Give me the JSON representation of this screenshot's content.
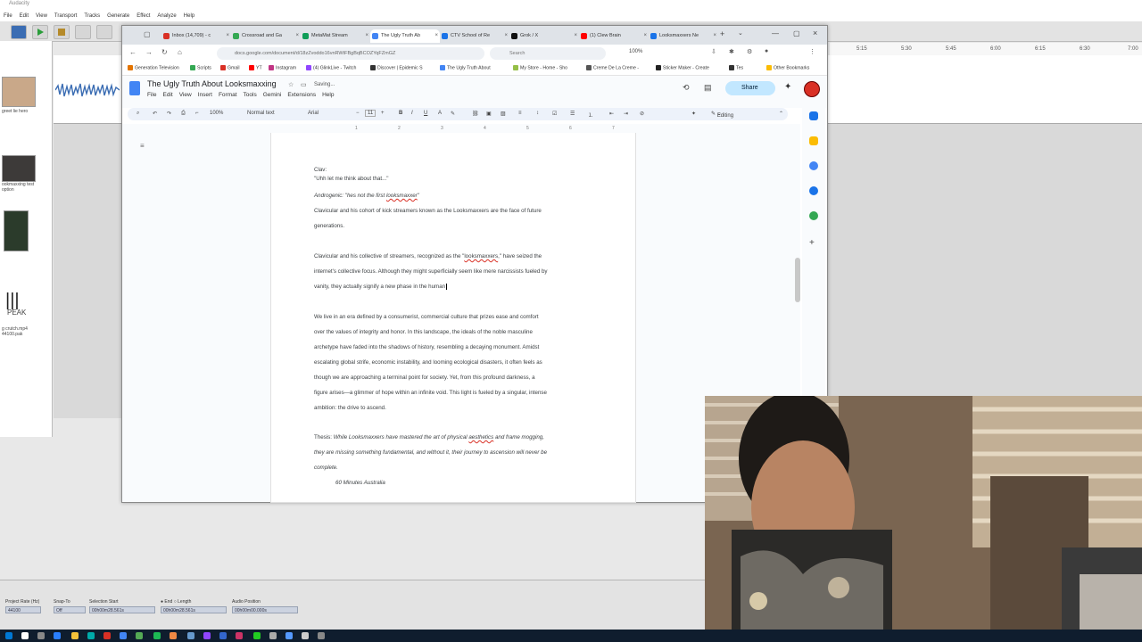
{
  "audacity": {
    "title": "Audacity",
    "menu": [
      "File",
      "Edit",
      "View",
      "Transport",
      "Tracks",
      "Generate",
      "Effect",
      "Analyze",
      "Help"
    ],
    "ruler_ticks": [
      "5:15",
      "5:30",
      "5:45",
      "6:00",
      "6:15",
      "6:30",
      "7:00"
    ],
    "left_items": [
      "greet lie hero",
      "ookmaxxing test option",
      "PEAK",
      "g crutch.mp4 44100.pak"
    ],
    "bottom": {
      "project_rate_label": "Project Rate (Hz)",
      "project_rate": "44100",
      "snap_label": "Snap-To",
      "snap_value": "Off",
      "selection_label": "Selection Start",
      "sel_start": "00h00m28.561s",
      "end_label": "End",
      "length_label": "Length",
      "sel_end": "00h00m28.561s",
      "audio_position_label": "Audio Position",
      "audio_position": "00h00m00.000s"
    }
  },
  "chrome": {
    "tabs": [
      {
        "label": "Inbox (14,709) - c",
        "color": "#d93025"
      },
      {
        "label": "Crossroad and Ga",
        "color": "#34a853"
      },
      {
        "label": "MetaMat Stream",
        "color": "#0f9d58"
      },
      {
        "label": "The Ugly Truth Ab",
        "color": "#4285f4"
      },
      {
        "label": "CTV School of Re",
        "color": "#1a73e8"
      },
      {
        "label": "Grok / X",
        "color": "#111111"
      },
      {
        "label": "(1) Clew Brain",
        "color": "#ff0000"
      },
      {
        "label": "Looksmaxxers Ne",
        "color": "#1a73e8"
      }
    ],
    "url": "docs.google.com/document/d/18zZvoddo16vnRWtFBgBqBCOZYqFZmGZ",
    "search_placeholder": "Search",
    "zoom_text": "100%",
    "bookmarks": [
      {
        "label": "Generation Television",
        "color": "#e37400"
      },
      {
        "label": "Scripts",
        "color": "#34a853"
      },
      {
        "label": "Gmail",
        "color": "#d93025"
      },
      {
        "label": "YT",
        "color": "#ff0000"
      },
      {
        "label": "Instagram",
        "color": "#c13584"
      },
      {
        "label": "(4) GlinkLive - Twitch",
        "color": "#9146ff"
      },
      {
        "label": "Discover | Epidemic S",
        "color": "#333333"
      },
      {
        "label": "The Ugly Truth About",
        "color": "#4285f4"
      },
      {
        "label": "My Store - Home - Sho",
        "color": "#95bf47"
      },
      {
        "label": "Creme De La Creme -",
        "color": "#555555"
      },
      {
        "label": "Sticker Maker - Create",
        "color": "#222222"
      },
      {
        "label": "Tes",
        "color": "#333333"
      },
      {
        "label": "Other Bookmarks",
        "color": "#fbbc04"
      }
    ]
  },
  "docs": {
    "title": "The Ugly Truth About Looksmaxxing",
    "saving": "Saving...",
    "menu": [
      "File",
      "Edit",
      "View",
      "Insert",
      "Format",
      "Tools",
      "Gemini",
      "Extensions",
      "Help"
    ],
    "share_label": "Share",
    "toolbar": {
      "zoom": "100%",
      "style": "Normal text",
      "font": "Arial",
      "size": "11",
      "mode": "Editing"
    },
    "ruler_ticks": [
      "1",
      "1",
      "2",
      "3",
      "4",
      "5",
      "6",
      "7"
    ],
    "body": {
      "p1_speaker": "Clav:",
      "p1_line": "\"Uhh let me think about that...\"",
      "p2_prefix": "Androgenic: \"hes not the first ",
      "p2_misspelled": "looksmaxxer",
      "p2_suffix": "\"",
      "p3_line1": "Clavicular and his cohort of kick streamers known as the Looksmaxxers are the face of future",
      "p3_line2": "generations.",
      "p4_line1_a": "Clavicular and his collective of streamers, recognized as the \"",
      "p4_line1_sp": "looksmaxxers",
      "p4_line1_b": ",\" have seized the",
      "p4_line2": "internet's collective focus. Although they might superficially seem like mere narcissists fueled by",
      "p4_line3": "vanity, they actually signify a new phase in the human",
      "p5_l1": "We live in an era defined by a consumerist, commercial culture that prizes ease and comfort",
      "p5_l2": "over the values of integrity and honor. In this landscape, the ideals of the noble masculine",
      "p5_l3": "archetype have faded into the shadows of history, resembling a decaying monument. Amidst",
      "p5_l4": "escalating global strife, economic instability, and looming ecological disasters, it often feels as",
      "p5_l5": "though we are approaching a terminal point for society. Yet, from this profound darkness, a",
      "p5_l6": "figure arises—a glimmer of hope within an infinite void. This light is fueled by a singular, intense",
      "p5_l7": "ambition: the drive to ascend.",
      "thesis_label": "Thesis:",
      "thesis_l1_a": "While Looksmaxxers have mastered the art of physical ",
      "thesis_l1_sp": "aesthetics",
      "thesis_l1_b": " and frame mogging,",
      "thesis_l2": "they are missing something fundamental, and without it, their journey to ascension will never be",
      "thesis_l3": "complete.",
      "source": "60 Minutes Australia"
    }
  }
}
